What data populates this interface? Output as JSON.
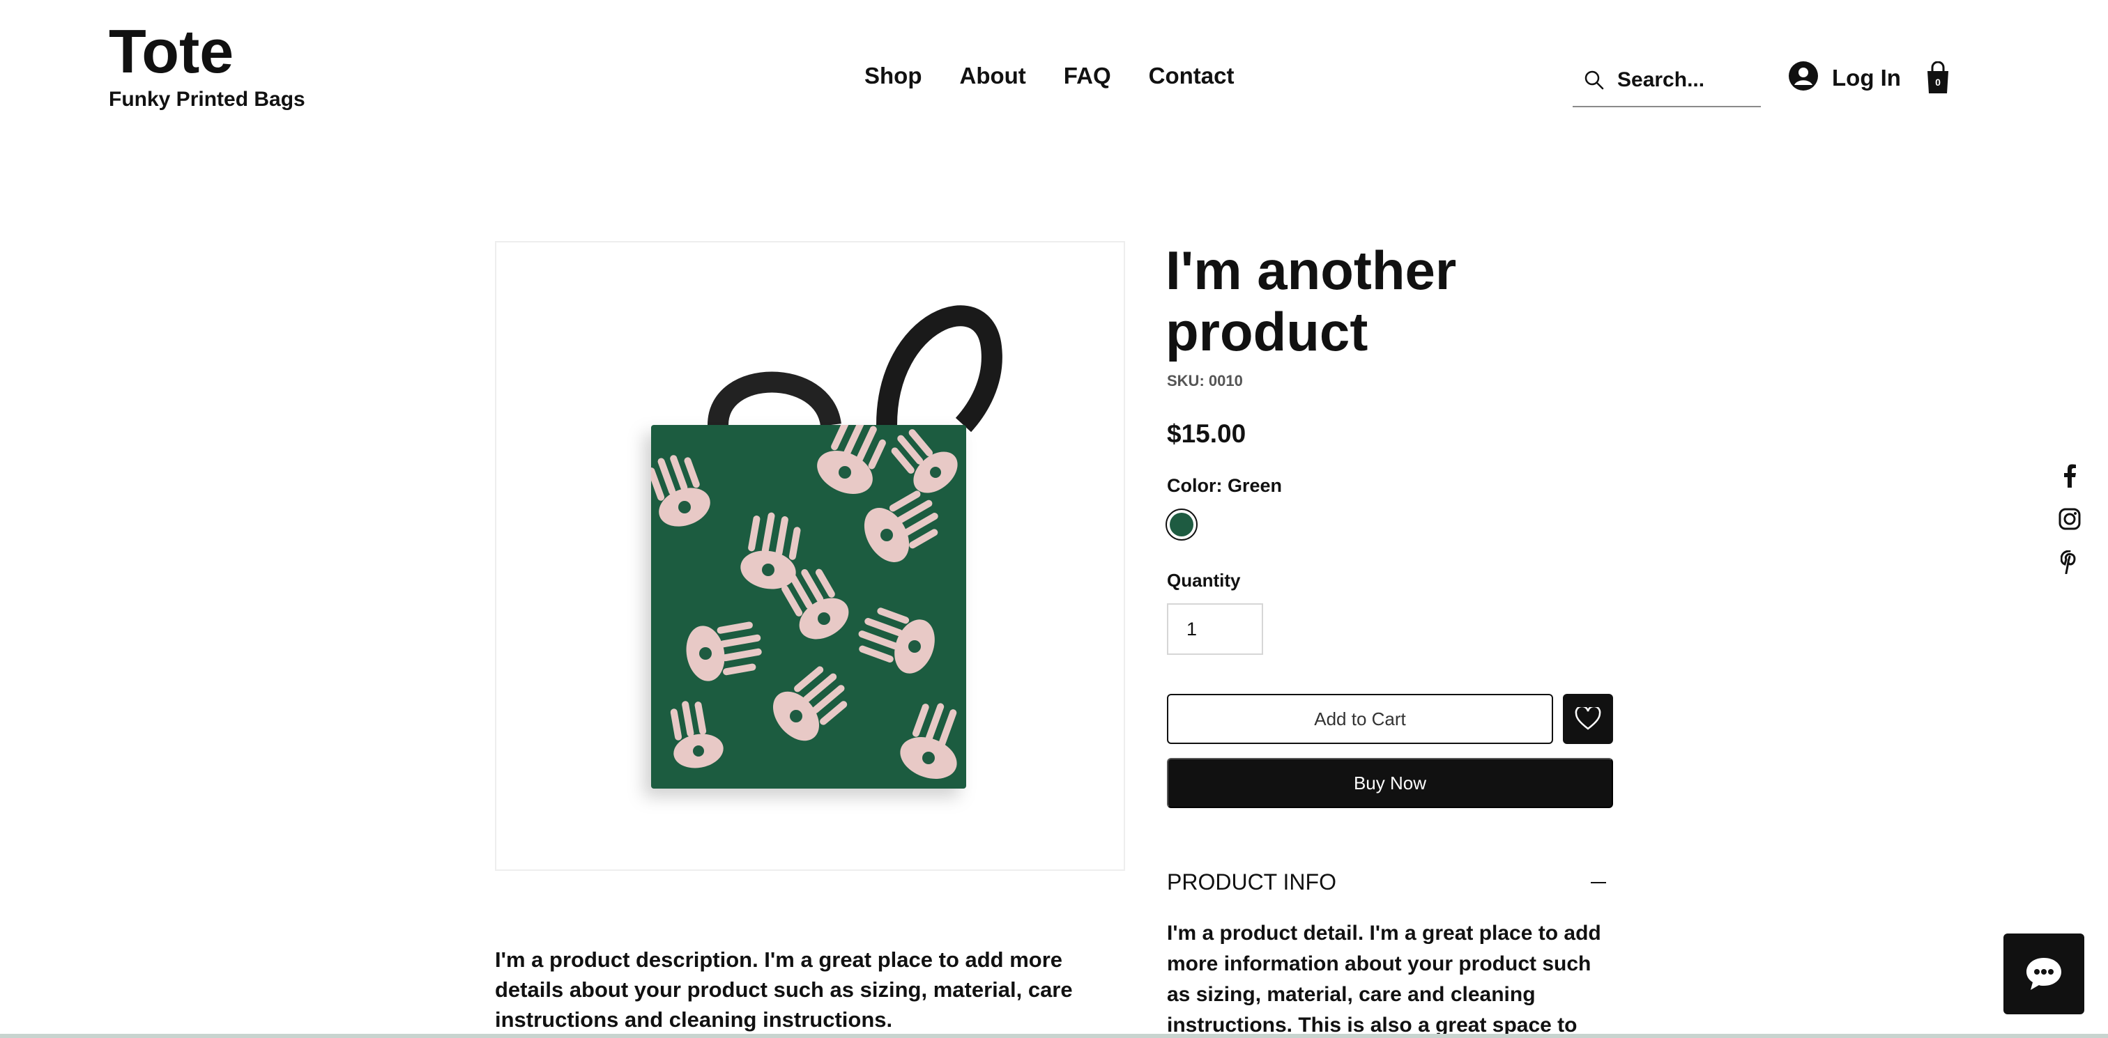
{
  "header": {
    "logo_title": "Tote",
    "logo_subtitle": "Funky Printed Bags",
    "nav": [
      "Shop",
      "About",
      "FAQ",
      "Contact"
    ],
    "search_placeholder": "Search...",
    "login_label": "Log In",
    "cart_count": "0"
  },
  "product": {
    "title": "I'm another product",
    "sku": "SKU: 0010",
    "price": "$15.00",
    "color_label": "Color: Green",
    "color_swatch": "#1e5b41",
    "quantity_label": "Quantity",
    "quantity_value": "1",
    "add_to_cart": "Add to Cart",
    "buy_now": "Buy Now",
    "description": "I'm a product description. I'm a great place to add more details about your product such as sizing, material, care instructions and cleaning instructions.",
    "info_title": "PRODUCT INFO",
    "info_text": "I'm a product detail. I'm a great place to add more information about your product such as sizing, material, care and cleaning instructions. This is also a great space to write what makes"
  },
  "social": [
    "facebook-icon",
    "instagram-icon",
    "pinterest-icon"
  ],
  "colors": {
    "text": "#111111",
    "bag_green": "#1e5b41",
    "bag_pattern": "#e8c9c6"
  }
}
